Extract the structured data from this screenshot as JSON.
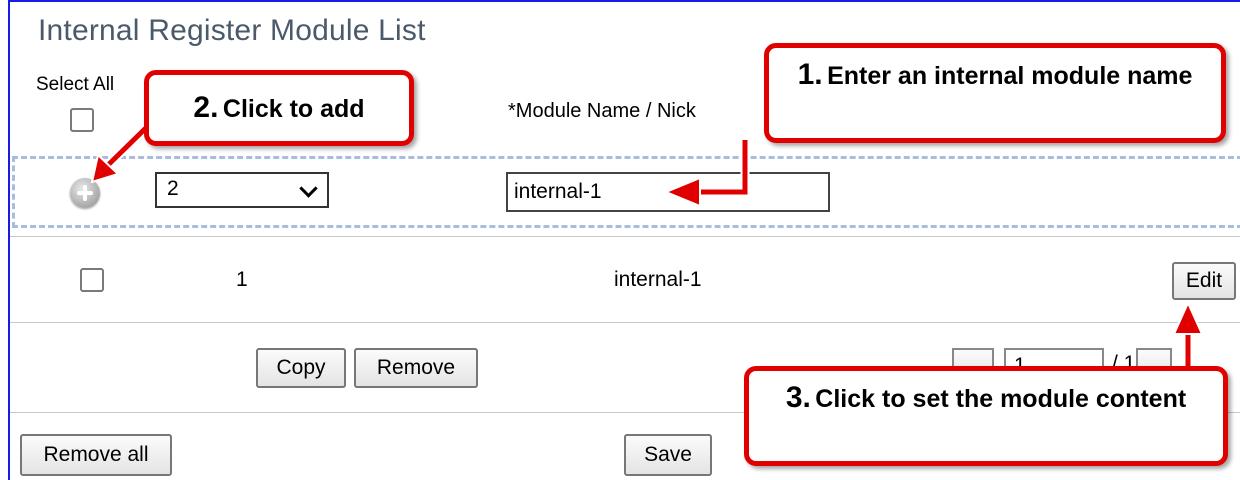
{
  "title": "Internal Register Module List",
  "header": {
    "select_all": "Select All",
    "module_name_col": "*Module Name / Nick"
  },
  "add_row": {
    "select_value": "2",
    "name_value": "internal-1"
  },
  "rows": [
    {
      "index": "1",
      "name": "internal-1",
      "edit_label": "Edit"
    }
  ],
  "actions": {
    "copy": "Copy",
    "remove": "Remove",
    "remove_all": "Remove all",
    "save": "Save"
  },
  "pager": {
    "page": "1",
    "total": "/ 1"
  },
  "callouts": [
    {
      "num": "1.",
      "text": "Enter an internal module name"
    },
    {
      "num": "2.",
      "text": "Click to add"
    },
    {
      "num": "3.",
      "text": "Click to set the module content"
    }
  ],
  "colors": {
    "callout_red": "#e00000",
    "title_gray": "#4a5a6a",
    "dashed_blue": "#aabcdd"
  }
}
